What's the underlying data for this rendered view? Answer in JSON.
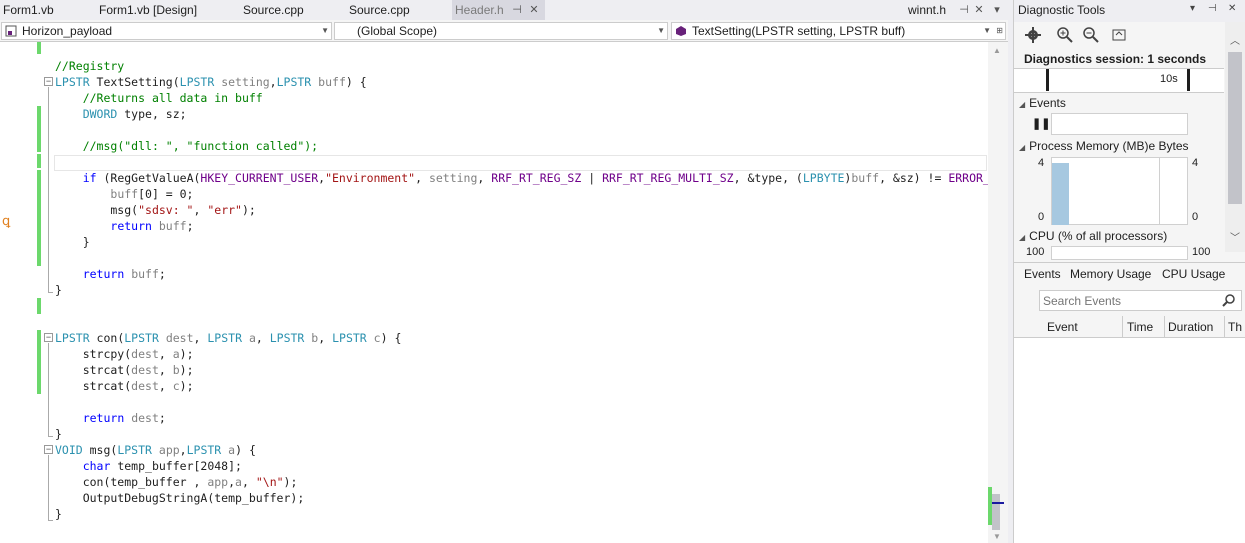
{
  "tabs": [
    {
      "label": "Form1.vb",
      "active": false
    },
    {
      "label": "Form1.vb [Design]",
      "active": false
    },
    {
      "label": "Source.cpp",
      "active": false
    },
    {
      "label": "Source.cpp",
      "active": false
    },
    {
      "label": "Header.h",
      "active": true
    }
  ],
  "tab_overflow_label": "winnt.h",
  "nav": {
    "project": "Horizon_payload",
    "scope": "(Global Scope)",
    "member": "TextSetting(LPSTR setting, LPSTR buff)"
  },
  "code": [
    "",
    "<span class='cm'>//Registry</span>",
    "<span class='ty'>LPSTR</span> TextSetting(<span class='ty'>LPSTR</span> <span class='pm'>setting</span>,<span class='ty'>LPSTR</span> <span class='pm'>buff</span>) {",
    "    <span class='cm'>//Returns all data in buff</span>",
    "    <span class='ty'>DWORD</span> type, sz;",
    "",
    "    <span class='cm'>//msg(\"dll: \", \"function called\");</span>",
    "",
    "    <span class='kw'>if</span> (RegGetValueA(<span class='mc'>HKEY_CURRENT_USER</span>,<span class='st'>\"Environment\"</span>, <span class='pm'>setting</span>, <span class='mc'>RRF_RT_REG_SZ</span> | <span class='mc'>RRF_RT_REG_MULTI_SZ</span>, &amp;type, (<span class='ty'>LPBYTE</span>)<span class='pm'>buff</span>, &amp;sz) != <span class='mc'>ERROR_SUCCESS</span>) {",
    "        <span class='pm'>buff</span>[0] = 0;",
    "        msg(<span class='st'>\"sdsv: \"</span>, <span class='st'>\"err\"</span>);",
    "        <span class='kw'>return</span> <span class='pm'>buff</span>;",
    "    }",
    "",
    "    <span class='kw'>return</span> <span class='pm'>buff</span>;",
    "}",
    "",
    "",
    "<span class='ty'>LPSTR</span> con(<span class='ty'>LPSTR</span> <span class='pm'>dest</span>, <span class='ty'>LPSTR</span> <span class='pm'>a</span>, <span class='ty'>LPSTR</span> <span class='pm'>b</span>, <span class='ty'>LPSTR</span> <span class='pm'>c</span>) {",
    "    strcpy(<span class='pm'>dest</span>, <span class='pm'>a</span>);",
    "    strcat(<span class='pm'>dest</span>, <span class='pm'>b</span>);",
    "    strcat(<span class='pm'>dest</span>, <span class='pm'>c</span>);",
    "",
    "    <span class='kw'>return</span> <span class='pm'>dest</span>;",
    "}",
    "<span class='ty'>VOID</span> msg(<span class='ty'>LPSTR</span> <span class='pm'>app</span>,<span class='ty'>LPSTR</span> <span class='pm'>a</span>) {",
    "    <span class='kw'>char</span> temp_buffer[2048];",
    "    con(temp_buffer , <span class='pm'>app</span>,<span class='pm'>a</span>, <span class='st'>\"\\n\"</span>);",
    "    OutputDebugStringA(temp_buffer);",
    "}"
  ],
  "diag": {
    "title": "Diagnostic Tools",
    "session": "Diagnostics session: 1 seconds",
    "timeline_label": "10s",
    "events_label": "Events",
    "memory_label": "Process Memory (MB)",
    "memory_suffix": "e Bytes",
    "memory_max": "4",
    "memory_min": "0",
    "memory_value_mb": 4,
    "cpu_label": "CPU (% of all processors)",
    "cpu_max": "100",
    "tabs": [
      "Events",
      "Memory Usage",
      "CPU Usage"
    ],
    "search_placeholder": "Search Events",
    "columns": [
      "Event",
      "Time",
      "Duration",
      "Th"
    ]
  },
  "colors": {
    "change_bar": "#6cd86c",
    "memory_bar": "#a6c8e0",
    "breakpoint_glyph": "#e08020"
  }
}
